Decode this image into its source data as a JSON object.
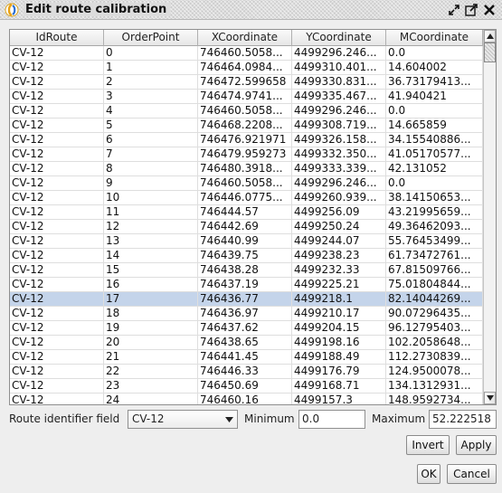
{
  "window": {
    "title": "Edit route calibration",
    "icon": "gvsig-icon",
    "controls": [
      "restore-icon",
      "maximize-icon",
      "close-icon"
    ]
  },
  "table": {
    "columns": [
      "IdRoute",
      "OrderPoint",
      "XCoordinate",
      "YCoordinate",
      "MCoordinate"
    ],
    "selected_row": 17,
    "rows": [
      [
        "CV-12",
        "0",
        "746460.5058...",
        "4499296.246...",
        "0.0"
      ],
      [
        "CV-12",
        "1",
        "746464.0984...",
        "4499310.401...",
        "14.604002"
      ],
      [
        "CV-12",
        "2",
        "746472.599658",
        "4499330.831...",
        "36.73179413..."
      ],
      [
        "CV-12",
        "3",
        "746474.9741...",
        "4499335.467...",
        "41.940421"
      ],
      [
        "CV-12",
        "4",
        "746460.5058...",
        "4499296.246...",
        "0.0"
      ],
      [
        "CV-12",
        "5",
        "746468.2208...",
        "4499308.719...",
        "14.665859"
      ],
      [
        "CV-12",
        "6",
        "746476.921971",
        "4499326.158...",
        "34.15540886..."
      ],
      [
        "CV-12",
        "7",
        "746479.959273",
        "4499332.350...",
        "41.05170577..."
      ],
      [
        "CV-12",
        "8",
        "746480.3918...",
        "4499333.339...",
        "42.131052"
      ],
      [
        "CV-12",
        "9",
        "746460.5058...",
        "4499296.246...",
        "0.0"
      ],
      [
        "CV-12",
        "10",
        "746446.0775...",
        "4499260.939...",
        "38.14150653..."
      ],
      [
        "CV-12",
        "11",
        "746444.57",
        "4499256.09",
        "43.21995659..."
      ],
      [
        "CV-12",
        "12",
        "746442.69",
        "4499250.24",
        "49.36462093..."
      ],
      [
        "CV-12",
        "13",
        "746440.99",
        "4499244.07",
        "55.76453499..."
      ],
      [
        "CV-12",
        "14",
        "746439.75",
        "4499238.23",
        "61.73472761..."
      ],
      [
        "CV-12",
        "15",
        "746438.28",
        "4499232.33",
        "67.81509766..."
      ],
      [
        "CV-12",
        "16",
        "746437.19",
        "4499225.21",
        "75.01804844..."
      ],
      [
        "CV-12",
        "17",
        "746436.77",
        "4499218.1",
        "82.14044269..."
      ],
      [
        "CV-12",
        "18",
        "746436.97",
        "4499210.17",
        "90.07296435..."
      ],
      [
        "CV-12",
        "19",
        "746437.62",
        "4499204.15",
        "96.12795403..."
      ],
      [
        "CV-12",
        "20",
        "746438.65",
        "4499198.16",
        "102.2058648..."
      ],
      [
        "CV-12",
        "21",
        "746441.45",
        "4499188.49",
        "112.2730839..."
      ],
      [
        "CV-12",
        "22",
        "746446.33",
        "4499176.79",
        "124.9500078..."
      ],
      [
        "CV-12",
        "23",
        "746450.69",
        "4499168.71",
        "134.1312931..."
      ],
      [
        "CV-12",
        "24",
        "746460.16",
        "4499157.3",
        "148.9592734..."
      ]
    ]
  },
  "form": {
    "route_field_label": "Route identifier field",
    "route_field_value": "CV-12",
    "minimum_label": "Minimum",
    "minimum_value": "0.0",
    "maximum_label": "Maximum",
    "maximum_value": "52.222518"
  },
  "buttons": {
    "invert": "Invert",
    "apply": "Apply",
    "ok": "OK",
    "cancel": "Cancel"
  }
}
